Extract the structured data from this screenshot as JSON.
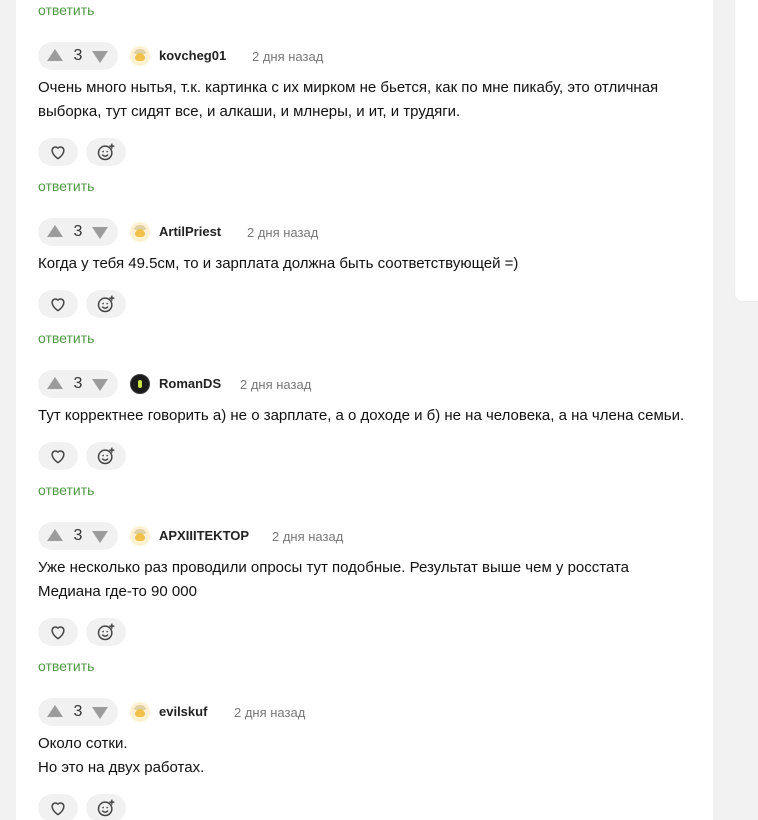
{
  "reply_label": "ответить",
  "comments": [
    {
      "score": "3",
      "username": "kovcheg01",
      "time": "2 дня назад",
      "lines": [
        "Очень много нытья, т.к. картинка с их мирком не бьется, как по мне пикабу, это отличная",
        "выборка, тут сидят все, и алкаши, и млнеры, и ит, и трудяги."
      ]
    },
    {
      "score": "3",
      "username": "ArtilPriest",
      "time": "2 дня назад",
      "lines": [
        "Когда у тебя 49.5см, то и зарплата должна быть соответствующей =)"
      ]
    },
    {
      "score": "3",
      "username": "RomanDS",
      "time": "2 дня назад",
      "lines": [
        "Тут корректнее говорить а) не о зарплате, а о доходе и б) не на человека, а на члена семьи."
      ]
    },
    {
      "score": "3",
      "username": "APXIIITEKTOP",
      "time": "2 дня назад",
      "lines": [
        "Уже несколько раз проводили опросы тут подобные. Результат выше чем у росстата",
        "Медиана где-то 90 000"
      ]
    },
    {
      "score": "3",
      "username": "evilskuf",
      "time": "2 дня назад",
      "lines": [
        "Около сотки.",
        "Но это на двух работах."
      ]
    }
  ]
}
